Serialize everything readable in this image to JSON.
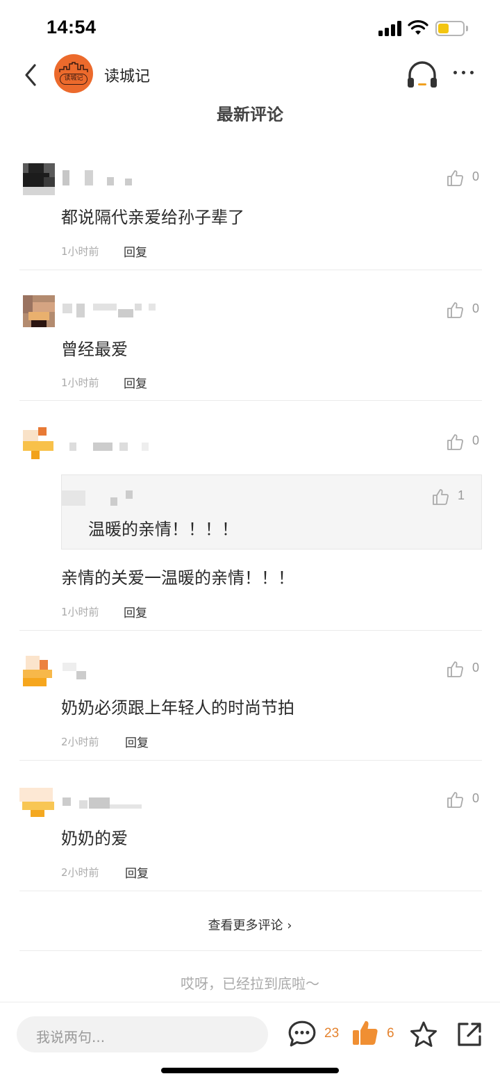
{
  "status_bar": {
    "time": "14:54"
  },
  "nav": {
    "account_name": "读城记",
    "avatar_logo_text": "读城记"
  },
  "section": {
    "title": "最新评论"
  },
  "comments": [
    {
      "text": "都说隔代亲爱给孙子辈了",
      "time": "1小时前",
      "reply": "回复",
      "likes": "0"
    },
    {
      "text": "曾经最爱",
      "time": "1小时前",
      "reply": "回复",
      "likes": "0"
    },
    {
      "text": "亲情的关爱一温暖的亲情！！！",
      "time": "1小时前",
      "reply": "回复",
      "likes": "0",
      "quote": {
        "text": "温暖的亲情！！！！",
        "likes": "1"
      }
    },
    {
      "text": "奶奶必须跟上年轻人的时尚节拍",
      "time": "2小时前",
      "reply": "回复",
      "likes": "0"
    },
    {
      "text": "奶奶的爱",
      "time": "2小时前",
      "reply": "回复",
      "likes": "0"
    }
  ],
  "more_comments": "查看更多评论 ›",
  "bottom_note": "哎呀，已经拉到底啦～",
  "bottom_bar": {
    "input_placeholder": "我说两句...",
    "comment_count": "23",
    "like_count": "6",
    "icons": [
      "comment-bubble-icon",
      "thumbs-up-filled-icon",
      "star-icon",
      "share-icon"
    ]
  },
  "colors": {
    "accent": "#e4822d",
    "brand_avatar": "#ec6a2c",
    "battery": "#f3c511"
  }
}
